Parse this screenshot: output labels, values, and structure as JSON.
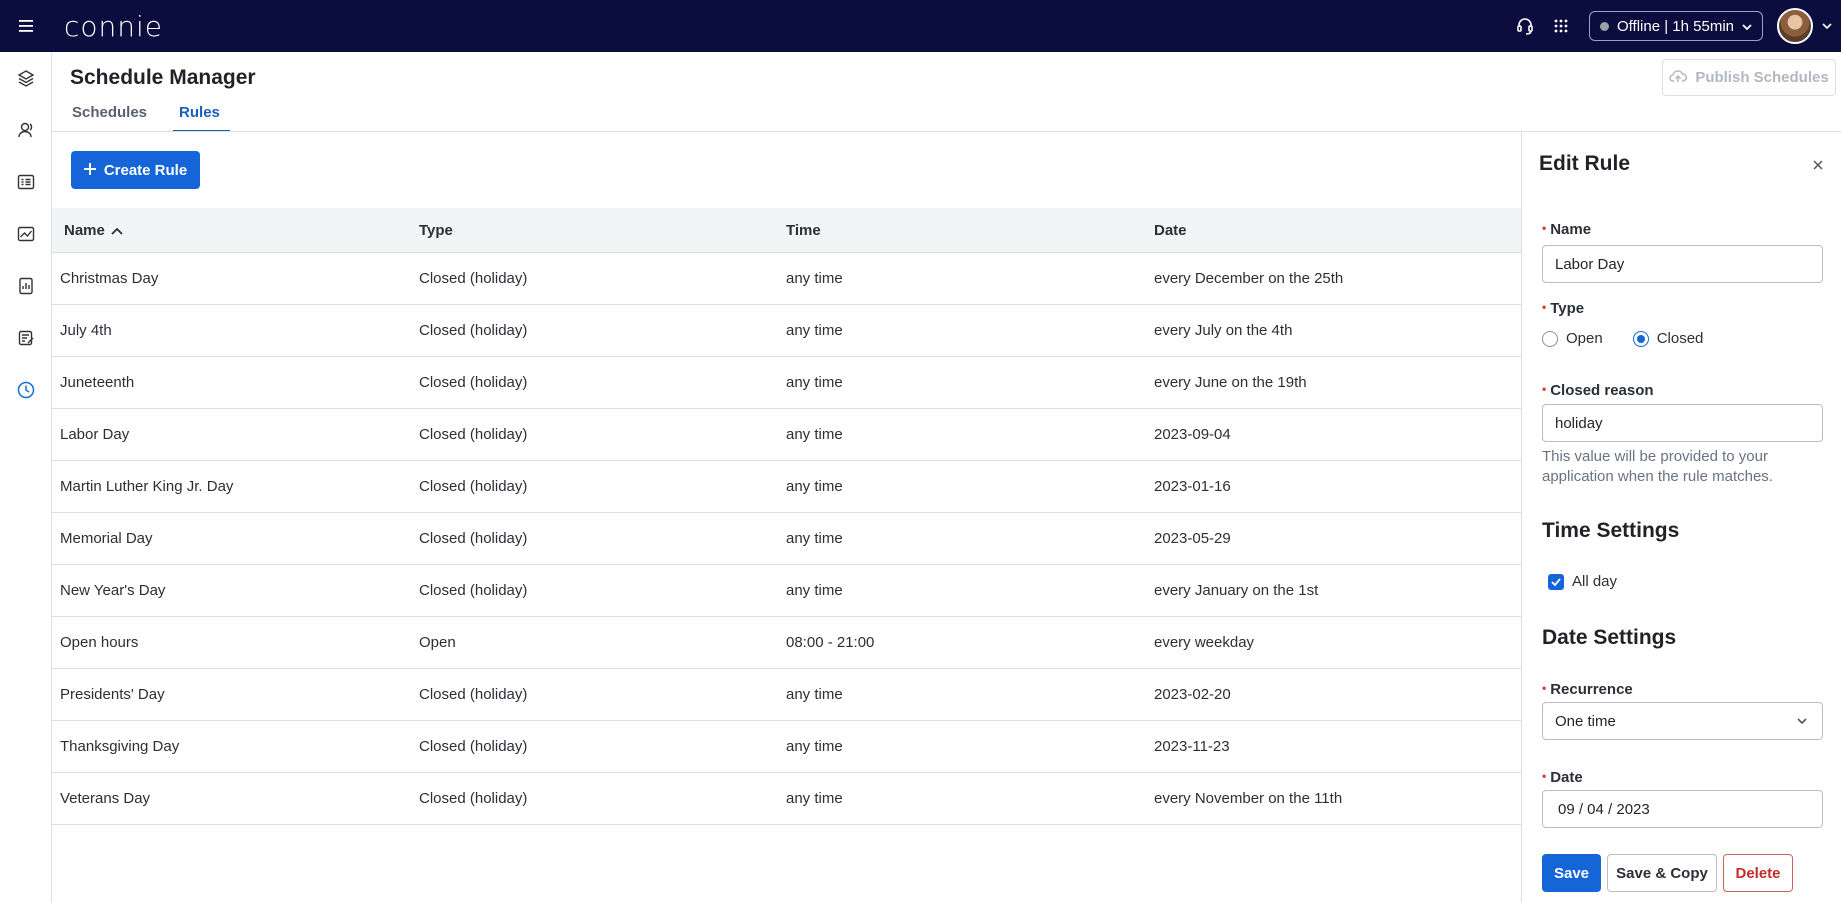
{
  "app": {
    "logo_text": "connie",
    "status": "Offline | 1h 55min",
    "icons": [
      "menu-icon",
      "headset-icon",
      "apps-grid-icon",
      "chevron-down-icon"
    ]
  },
  "rail": {
    "items": [
      {
        "name": "layers-icon"
      },
      {
        "name": "contacts-icon"
      },
      {
        "name": "list-icon"
      },
      {
        "name": "analytics-icon"
      },
      {
        "name": "reports-icon"
      },
      {
        "name": "tasks-icon"
      },
      {
        "name": "schedule-icon",
        "active": true
      }
    ]
  },
  "header": {
    "title": "Schedule Manager",
    "tabs": [
      {
        "label": "Schedules"
      },
      {
        "label": "Rules",
        "active": true
      }
    ],
    "publish_label": "Publish Schedules"
  },
  "main": {
    "create_label": "Create Rule",
    "columns": [
      "Name",
      "Type",
      "Time",
      "Date"
    ],
    "rows": [
      {
        "name": "Christmas Day",
        "type": "Closed (holiday)",
        "time": "any time",
        "date": "every December on the 25th"
      },
      {
        "name": "July 4th",
        "type": "Closed (holiday)",
        "time": "any time",
        "date": "every July on the 4th"
      },
      {
        "name": "Juneteenth",
        "type": "Closed (holiday)",
        "time": "any time",
        "date": "every June on the 19th"
      },
      {
        "name": "Labor Day",
        "type": "Closed (holiday)",
        "time": "any time",
        "date": "2023-09-04"
      },
      {
        "name": "Martin Luther King Jr. Day",
        "type": "Closed (holiday)",
        "time": "any time",
        "date": "2023-01-16"
      },
      {
        "name": "Memorial Day",
        "type": "Closed (holiday)",
        "time": "any time",
        "date": "2023-05-29"
      },
      {
        "name": "New Year's Day",
        "type": "Closed (holiday)",
        "time": "any time",
        "date": "every January on the 1st"
      },
      {
        "name": "Open hours",
        "type": "Open",
        "time": "08:00 - 21:00",
        "date": "every weekday"
      },
      {
        "name": "Presidents' Day",
        "type": "Closed (holiday)",
        "time": "any time",
        "date": "2023-02-20"
      },
      {
        "name": "Thanksgiving Day",
        "type": "Closed (holiday)",
        "time": "any time",
        "date": "2023-11-23"
      },
      {
        "name": "Veterans Day",
        "type": "Closed (holiday)",
        "time": "any time",
        "date": "every November on the 11th"
      }
    ]
  },
  "panel": {
    "title": "Edit Rule",
    "name_label": "Name",
    "name_value": "Labor Day",
    "type_label": "Type",
    "type_options": [
      {
        "label": "Open",
        "checked": false
      },
      {
        "label": "Closed",
        "checked": true
      }
    ],
    "reason_label": "Closed reason",
    "reason_value": "holiday",
    "reason_help": "This value will be provided to your application when the rule matches.",
    "time_section": "Time Settings",
    "all_day_label": "All day",
    "all_day_checked": true,
    "date_section": "Date Settings",
    "recurrence_label": "Recurrence",
    "recurrence_value": "One time",
    "date_label": "Date",
    "date_value": "09 / 04 / 2023",
    "save_label": "Save",
    "save_copy_label": "Save & Copy",
    "delete_label": "Delete"
  },
  "colors": {
    "topbar": "#0b0d3e",
    "primary": "#1565d8",
    "danger": "#c42b2b"
  }
}
